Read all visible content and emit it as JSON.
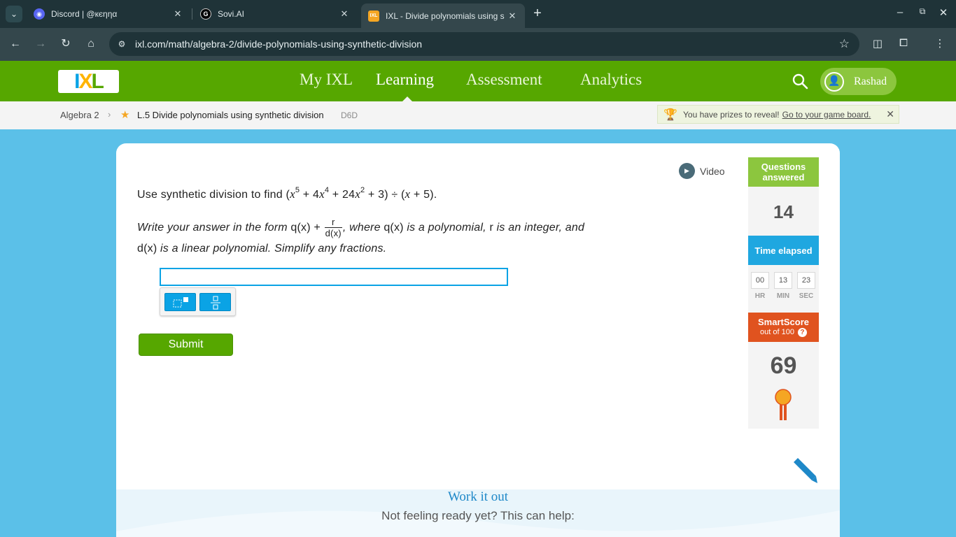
{
  "browser": {
    "tabs": [
      {
        "title": "Discord | @кєηηα",
        "favicon": "discord-icon"
      },
      {
        "title": "Sovi.AI",
        "favicon": "sovi-icon"
      },
      {
        "title": "IXL - Divide polynomials using s",
        "favicon": "ixl-icon",
        "active": true
      }
    ],
    "url": "ixl.com/math/algebra-2/divide-polynomials-using-synthetic-division"
  },
  "header": {
    "logo_text": {
      "i": "I",
      "x": "X",
      "l": "L"
    },
    "nav": [
      "My IXL",
      "Learning",
      "Assessment",
      "Analytics"
    ],
    "active_nav": "Learning",
    "user_name": "Rashad",
    "brand_color": "#56a700"
  },
  "breadcrumb": {
    "subject": "Algebra 2",
    "skill": "L.5 Divide polynomials using synthetic division",
    "code": "D6D"
  },
  "prize": {
    "text": "You have prizes to reveal!",
    "link": "Go to your game board."
  },
  "video_label": "Video",
  "question": {
    "lead": "Use synthetic division to find (",
    "x": "x",
    "exp5": "5",
    "t2": " + 4",
    "exp4": "4",
    "t3": " + 24",
    "exp2": "2",
    "t4": " + 3) ÷ (",
    "t5": " + 5)."
  },
  "instruction": {
    "p1": "Write your answer in the form ",
    "qx": "q(x)",
    "plus": " + ",
    "frac_num": "r",
    "frac_den": "d(x)",
    "p2": ", where ",
    "p3": " is a polynomial, ",
    "r": "r",
    "p4": " is an integer, and",
    "dx": "d(x)",
    "p5": " is a linear polynomial. Simplify any fractions."
  },
  "answer": {
    "value": ""
  },
  "submit_label": "Submit",
  "stats": {
    "questions_label": "Questions answered",
    "questions_value": "14",
    "time_label": "Time elapsed",
    "time": {
      "hr": "00",
      "min": "13",
      "sec": "23"
    },
    "time_units": {
      "hr": "HR",
      "min": "MIN",
      "sec": "SEC"
    },
    "smartscore_label": "SmartScore",
    "smartscore_sub": "out of 100",
    "smartscore_value": "69",
    "colors": {
      "questions": "#8cc63e",
      "time": "#1fa7e0",
      "smartscore": "#e0531f"
    }
  },
  "work_it_out": {
    "title": "Work it out",
    "subtitle": "Not feeling ready yet? This can help:"
  }
}
